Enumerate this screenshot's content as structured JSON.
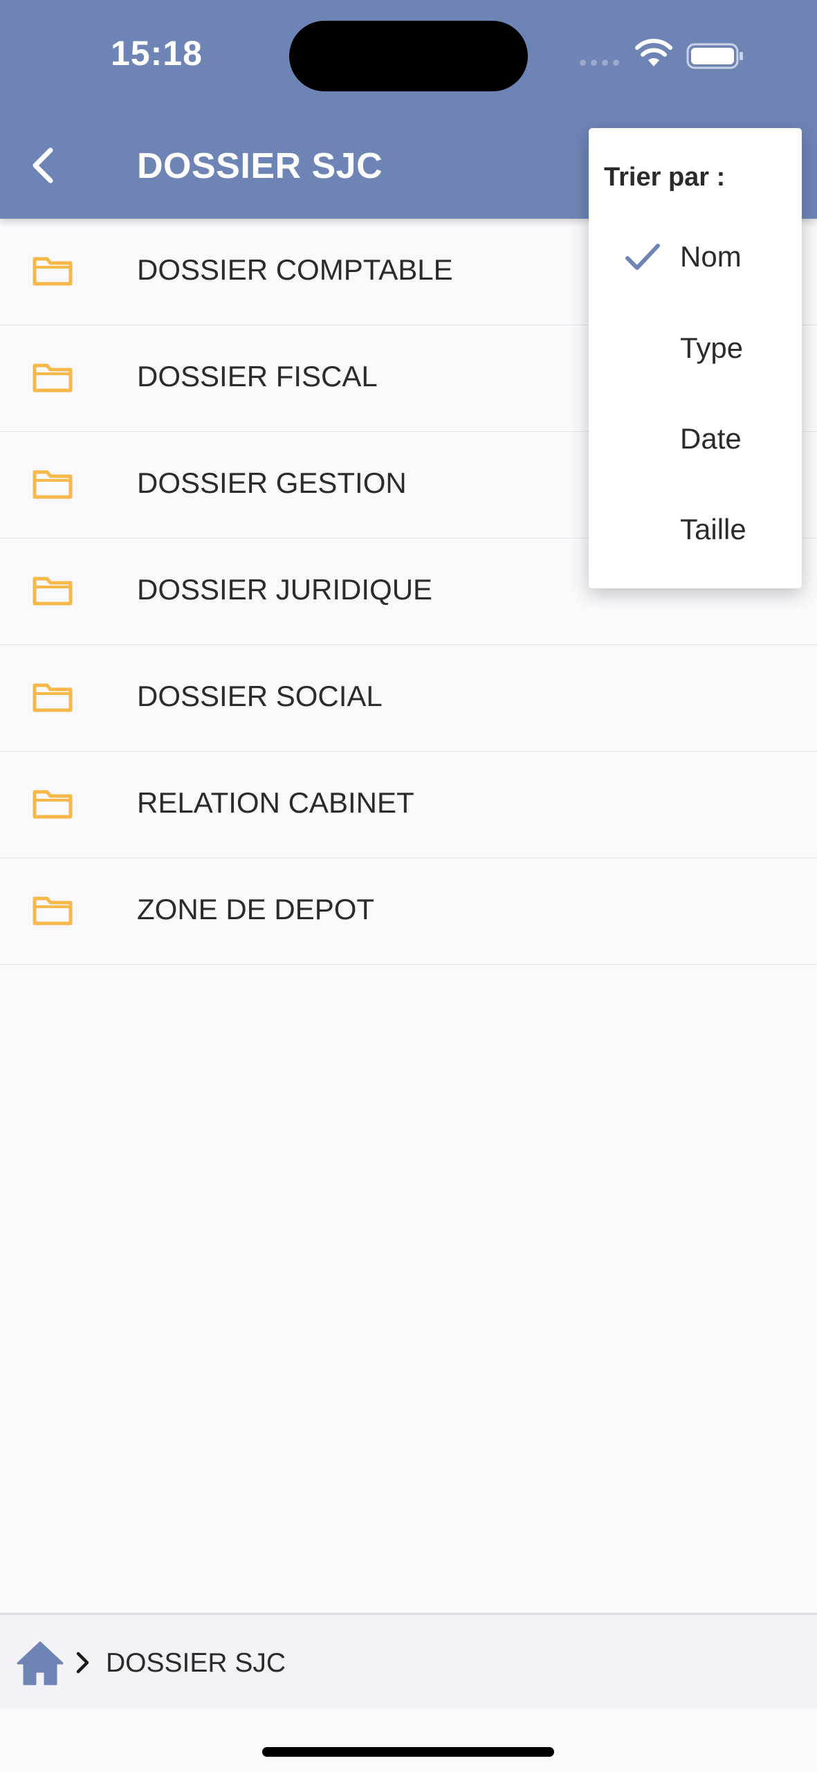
{
  "status_bar": {
    "time": "15:18"
  },
  "header": {
    "title": "DOSSIER SJC",
    "background_color": "#6d84b5"
  },
  "folders": [
    {
      "label": "DOSSIER COMPTABLE",
      "icon": "folder-icon"
    },
    {
      "label": "DOSSIER FISCAL",
      "icon": "folder-icon"
    },
    {
      "label": "DOSSIER GESTION",
      "icon": "folder-icon"
    },
    {
      "label": "DOSSIER JURIDIQUE",
      "icon": "folder-icon"
    },
    {
      "label": "DOSSIER SOCIAL",
      "icon": "folder-icon"
    },
    {
      "label": "RELATION CABINET",
      "icon": "folder-icon"
    },
    {
      "label": "ZONE DE DEPOT",
      "icon": "folder-icon"
    }
  ],
  "sort_menu": {
    "title": "Trier par :",
    "selected": "Nom",
    "options": [
      {
        "label": "Nom",
        "checked": true
      },
      {
        "label": "Type",
        "checked": false
      },
      {
        "label": "Date",
        "checked": false
      },
      {
        "label": "Taille",
        "checked": false
      }
    ]
  },
  "breadcrumb": {
    "home_icon": "home-icon",
    "current": "DOSSIER SJC"
  },
  "colors": {
    "accent": "#6d84b5",
    "folder": "#f7b84a",
    "checkmark": "#6d84b5"
  }
}
